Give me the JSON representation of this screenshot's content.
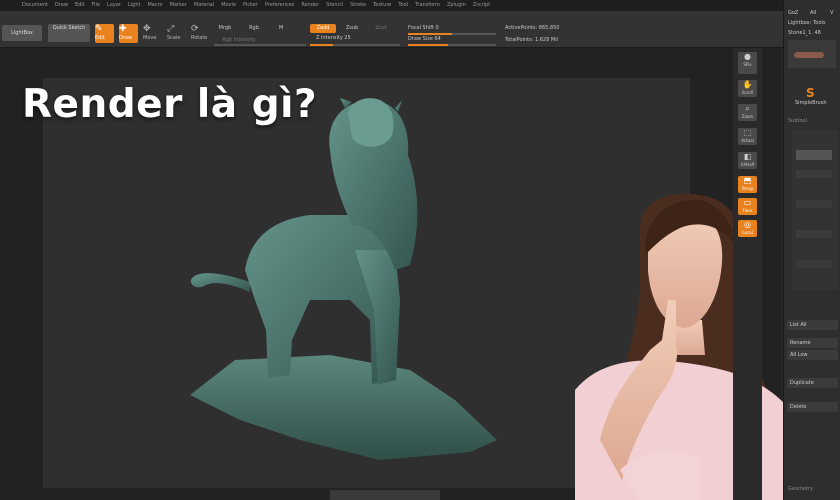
{
  "menubar": {
    "items": [
      "Document",
      "Draw",
      "Edit",
      "File",
      "Layer",
      "Light",
      "Macro",
      "Marker",
      "Material",
      "Movie",
      "Picker",
      "Preferences",
      "Render",
      "Stencil",
      "Stroke",
      "Texture",
      "Tool",
      "Transform",
      "Zplugin",
      "Zscript"
    ]
  },
  "toolbar": {
    "lightbox": "LightBox",
    "quick_sketch": "Quick Sketch",
    "tools": [
      "Edit",
      "Draw",
      "Move",
      "Scale",
      "Rotate"
    ],
    "mrgb": "Mrgb",
    "rgb": "Rgb",
    "m": "M",
    "rgb_intensity": "Rgb Intensity",
    "zadd": "Zadd",
    "zsub": "Zsub",
    "zcut": "Zcut",
    "z_intensity": "Z Intensity 25",
    "z_intensity_value": 25,
    "focal_shift": "Focal Shift 0",
    "draw_size": "Draw Size 64",
    "active_points": "ActivePoints: 865,850",
    "total_points": "TotalPoints: 1.628 Mil"
  },
  "headline": "Render là gì?",
  "right_shelf": {
    "buttons": [
      "SPix",
      "Scroll",
      "Zoom",
      "Actual",
      "AAHalf",
      "Persp",
      "Floor",
      "Local"
    ]
  },
  "side_panel": {
    "top_labels": [
      "GoZ",
      "All",
      "V"
    ],
    "lightbox_tools": "Lightbox› Tools",
    "tool_name": "Stone1_1. 48",
    "brush_name": "SimpleBrush",
    "subtool": "Subtool",
    "list_all": "List All",
    "rename": "Rename",
    "all_low": "All Low",
    "duplicate": "Duplicate",
    "delete": "Delete",
    "geometry": "Geometry"
  },
  "colors": {
    "accent": "#e8821e",
    "statue": "#4f7a70",
    "background": "#2f2f2f"
  }
}
